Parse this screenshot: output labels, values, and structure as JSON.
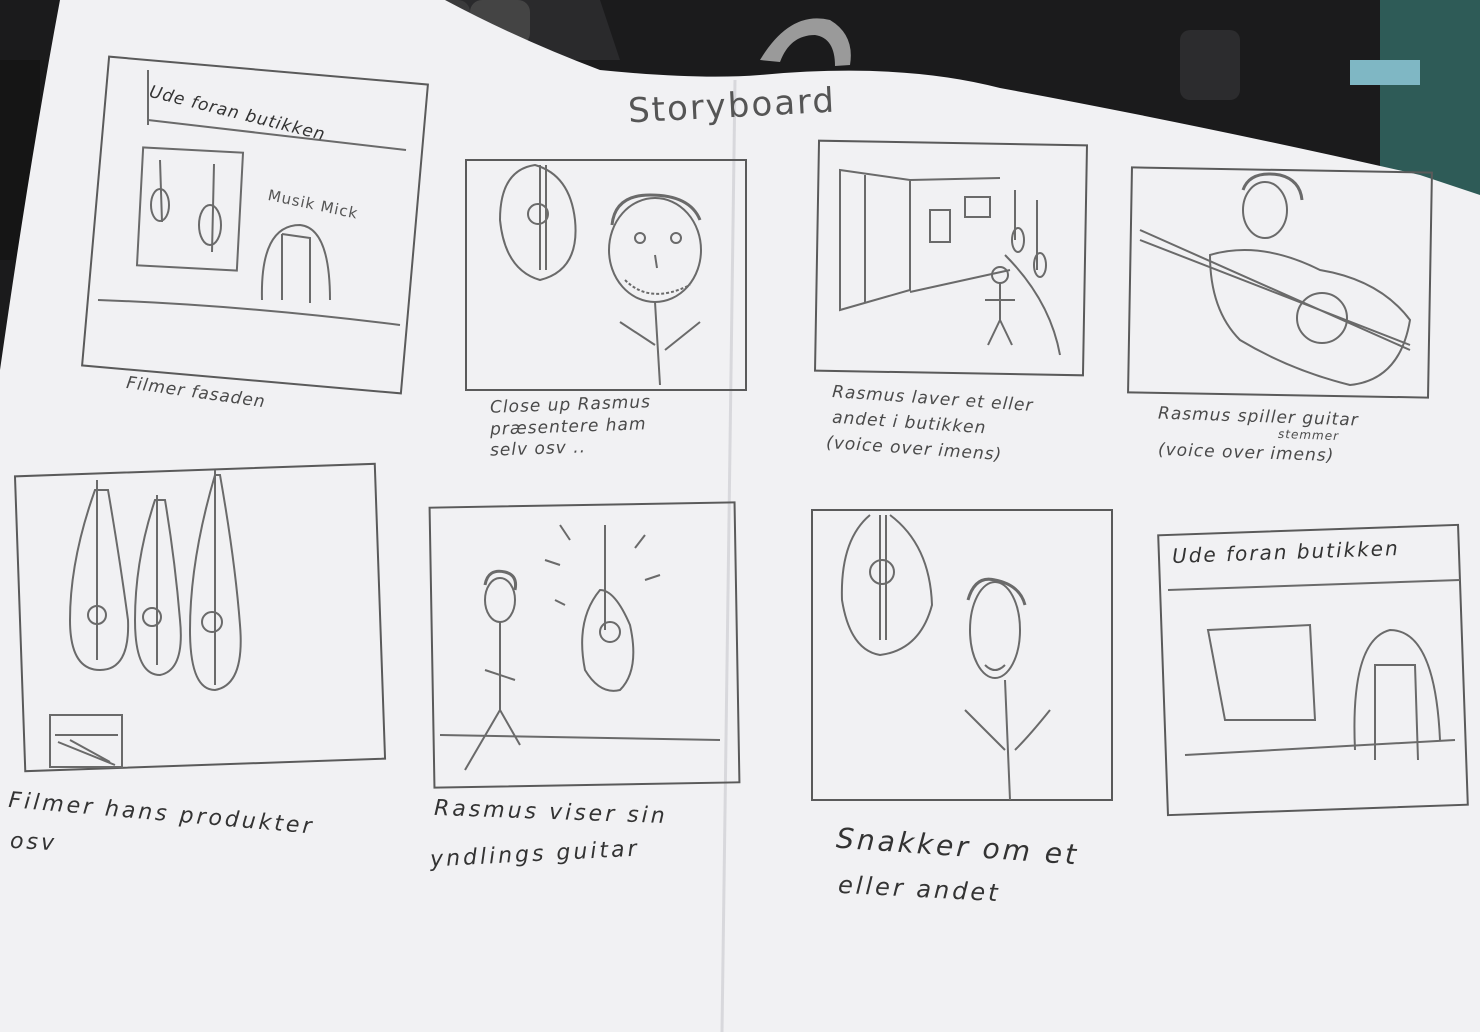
{
  "title": "Storyboard",
  "panels": [
    {
      "heading": "Ude foran butikken",
      "sign": "Musik Mick",
      "caption": [
        "Filmer fasaden"
      ]
    },
    {
      "caption": [
        "Close up Rasmus",
        "præsentere ham",
        "selv osv .."
      ]
    },
    {
      "caption": [
        "Rasmus laver et eller",
        "andet i butikken",
        "(voice over imens)"
      ]
    },
    {
      "caption": [
        "Rasmus spiller guitar",
        "(voice over imens)"
      ],
      "note": "stemmer"
    },
    {
      "caption": [
        "Filmer hans produkter",
        "osv"
      ]
    },
    {
      "caption": [
        "Rasmus viser sin",
        "yndlings guitar"
      ]
    },
    {
      "caption": [
        "Snakker om et",
        "eller andet"
      ]
    },
    {
      "heading": "Ude foran butikken",
      "caption": []
    }
  ],
  "colors": {
    "paper": "#f1f1f3",
    "pencil": "#6a6a6a",
    "background": "#1b1b1c"
  }
}
